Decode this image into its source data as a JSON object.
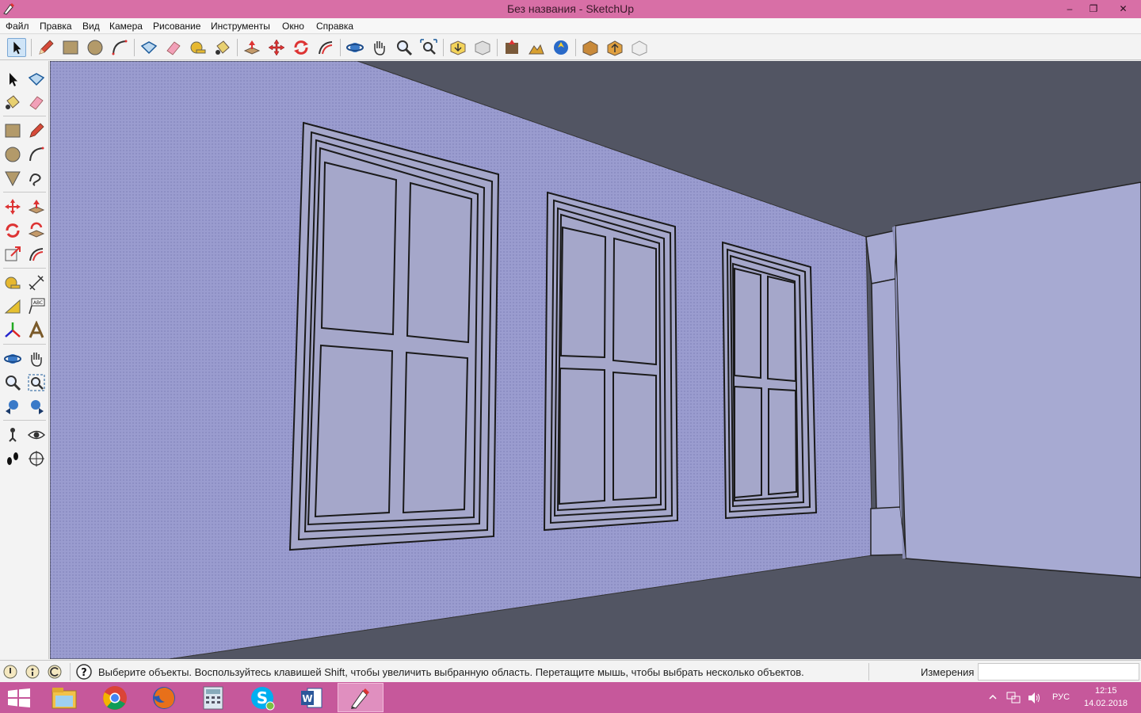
{
  "window": {
    "title": "Без названия - SketchUp",
    "controls": {
      "minimize": "–",
      "maximize": "❐",
      "close": "✕"
    }
  },
  "menu": {
    "items": [
      "Файл",
      "Правка",
      "Вид",
      "Камера",
      "Рисование",
      "Инструменты",
      "Окно",
      "Справка"
    ]
  },
  "toolbar": {
    "tools": [
      "select-icon",
      "pencil-icon",
      "rectangle-icon",
      "circle-icon",
      "arc-icon",
      "make-component-icon",
      "eraser-icon",
      "tape-measure-icon",
      "paint-bucket-icon",
      "push-pull-icon",
      "move-icon",
      "rotate-icon",
      "follow-me-icon",
      "orbit-icon",
      "pan-icon",
      "zoom-icon",
      "zoom-extents-icon",
      "get-models-icon",
      "share-model-icon",
      "add-location-icon",
      "toggle-terrain-icon",
      "photo-textures-icon",
      "get-models-warehouse-icon",
      "share-component-icon",
      "extension-icon"
    ]
  },
  "left_toolbar": {
    "tools": [
      "select-icon",
      "make-component-icon",
      "paint-bucket-icon",
      "eraser-icon",
      "rectangle-icon",
      "line-icon",
      "circle-icon",
      "arc-icon",
      "polygon-icon",
      "freehand-icon",
      "move-icon",
      "push-pull-icon",
      "rotate-icon",
      "follow-me-icon",
      "scale-icon",
      "offset-icon",
      "tape-measure-icon",
      "dimensions-icon",
      "protractor-icon",
      "text-icon",
      "axes-icon",
      "3d-text-icon",
      "orbit-icon",
      "pan-icon",
      "zoom-icon",
      "zoom-window-icon",
      "previous-view-icon",
      "next-view-icon",
      "position-camera-icon",
      "look-around-icon",
      "walk-icon",
      "section-plane-icon"
    ]
  },
  "status": {
    "message": "Выберите объекты. Воспользуйтесь клавишей Shift, чтобы увеличить выбранную область. Перетащите мышь, чтобы выбрать несколько объектов.",
    "measurements_label": "Измерения",
    "measurements_value": ""
  },
  "taskbar": {
    "apps": [
      "explorer-icon",
      "chrome-icon",
      "firefox-icon",
      "calculator-icon",
      "skype-icon",
      "word-icon",
      "sketchup-icon"
    ],
    "active_app": "sketchup-icon",
    "language": "РУС",
    "time": "12:15",
    "date": "14.02.2018"
  },
  "colors": {
    "titlebar": "#d86fa6",
    "taskbar": "#c6589b",
    "wall": "#9a9ccf",
    "right_wall": "#a7aad2",
    "ceiling_floor": "#525563",
    "window_glass": "#a5a7ca"
  }
}
